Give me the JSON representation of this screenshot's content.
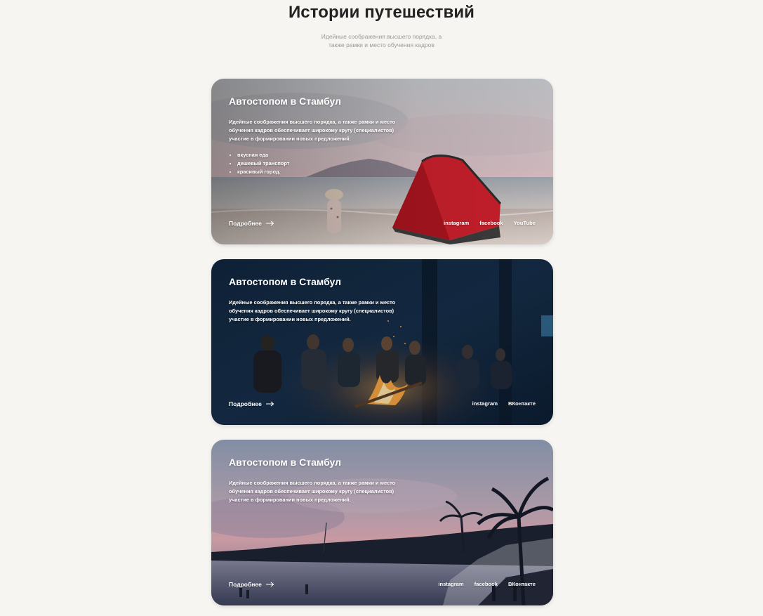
{
  "header": {
    "title": "Истории путешествий",
    "subtitle_line1": "Идейные соображения высшего порядка, а",
    "subtitle_line2": "также рамки и место обучения кадров"
  },
  "cards": [
    {
      "title": "Автостопом в Стамбул",
      "text": "Идейные соображения высшего порядка, а также рамки и место обучения кадров обеспечивает широкому кругу (специалистов) участие в формировании новых предложений:",
      "list": [
        "вкусная еда",
        "дешевый транспорт",
        "красивый город."
      ],
      "more_label": "Подробнее",
      "socials": [
        "instagram",
        "facebook",
        "YouTube"
      ],
      "icon": "arrow-right-icon"
    },
    {
      "title": "Автостопом в Стамбул",
      "text": "Идейные соображения высшего порядка, а также рамки и место обучения кадров обеспечивает широкому кругу (специалистов) участие в формировании новых предложений.",
      "more_label": "Подробнее",
      "socials": [
        "instagram",
        "ВКонтакте"
      ],
      "icon": "arrow-right-icon"
    },
    {
      "title": "Автостопом в Стамбул",
      "text": "Идейные соображения высшего порядка, а также рамки и место обучения кадров обеспечивает широкому кругу (специалистов) участие в формировании новых предложений.",
      "more_label": "Подробнее",
      "socials": [
        "instagram",
        "facebook",
        "ВКонтакте"
      ],
      "icon": "arrow-right-icon"
    }
  ],
  "colors": {
    "page_bg": "#f6f5f2",
    "tent_red": "#c21f2a",
    "campfire": "#f7a23a",
    "night_blue": "#0f2238",
    "sunset_pink": "#d9a7b0"
  }
}
